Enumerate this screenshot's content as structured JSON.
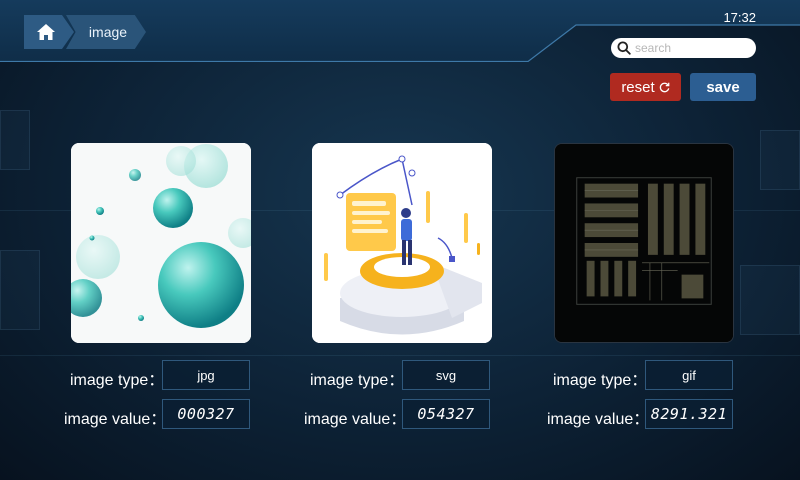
{
  "header": {
    "breadcrumb": {
      "home_icon": "home-icon",
      "current": "image"
    },
    "time": "17:32",
    "search": {
      "placeholder": "search",
      "value": "",
      "icon": "search-icon"
    }
  },
  "toolbar": {
    "reset_label": "reset",
    "reset_icon": "refresh-icon",
    "save_label": "save",
    "colors": {
      "reset": "#b02a20",
      "save": "#2c5e92"
    }
  },
  "cards": [
    {
      "type_label": "image type：",
      "type": "jpg",
      "value_label": "image value：",
      "value": "000327"
    },
    {
      "type_label": "image type：",
      "type": "svg",
      "value_label": "image value：",
      "value": "054327"
    },
    {
      "type_label": "image type：",
      "type": "gif",
      "value_label": "image value：",
      "value": "8291.321"
    }
  ],
  "theme": {
    "background": "#0d2236",
    "panel": "#153b5c",
    "accent": "#2e5b84"
  }
}
